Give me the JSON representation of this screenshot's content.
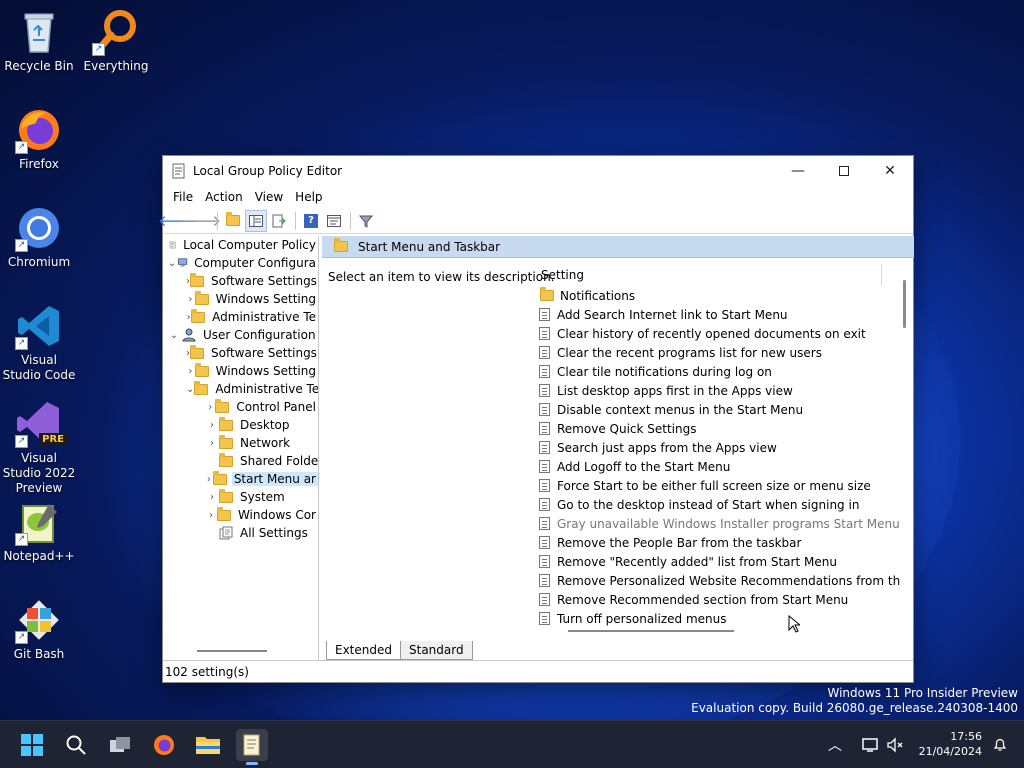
{
  "desktop": {
    "icons": [
      {
        "label": "Recycle Bin"
      },
      {
        "label": "Everything"
      },
      {
        "label": "Firefox"
      },
      {
        "label": "Chromium"
      },
      {
        "label": "Visual Studio Code"
      },
      {
        "label": "Visual Studio 2022 Preview",
        "badge": "PRE"
      },
      {
        "label": "Notepad++"
      },
      {
        "label": "Git Bash"
      }
    ]
  },
  "window": {
    "title": "Local Group Policy Editor",
    "menu": [
      "File",
      "Action",
      "View",
      "Help"
    ],
    "tree": [
      {
        "label": "Local Computer Policy"
      },
      {
        "label": "Computer Configura"
      },
      {
        "label": "Software Settings"
      },
      {
        "label": "Windows Setting"
      },
      {
        "label": "Administrative Te"
      },
      {
        "label": "User Configuration"
      },
      {
        "label": "Software Settings"
      },
      {
        "label": "Windows Setting"
      },
      {
        "label": "Administrative Te"
      },
      {
        "label": "Control Panel"
      },
      {
        "label": "Desktop"
      },
      {
        "label": "Network"
      },
      {
        "label": "Shared Folder"
      },
      {
        "label": "Start Menu ar"
      },
      {
        "label": "System"
      },
      {
        "label": "Windows Cor"
      },
      {
        "label": "All Settings"
      }
    ],
    "header": "Start Menu and Taskbar",
    "description": "Select an item to view its description.",
    "list_header": "Setting",
    "settings": [
      "Notifications",
      "Add Search Internet link to Start Menu",
      "Clear history of recently opened documents on exit",
      "Clear the recent programs list for new users",
      "Clear tile notifications during log on",
      "List desktop apps first in the Apps view",
      "Disable context menus in the Start Menu",
      "Remove Quick Settings",
      "Search just apps from the Apps view",
      "Add Logoff to the Start Menu",
      "Force Start to be either full screen size or menu size",
      "Go to the desktop instead of Start when signing in",
      "Gray unavailable Windows Installer programs Start Menu shortcuts",
      "Remove the People Bar from the taskbar",
      "Remove \"Recently added\" list from Start Menu",
      "Remove Personalized Website Recommendations from the ...",
      "Remove Recommended section from Start Menu",
      "Turn off personalized menus"
    ],
    "tabs": [
      "Extended",
      "Standard"
    ],
    "status": "102 setting(s)"
  },
  "watermark": {
    "line1": "Windows 11 Pro Insider Preview",
    "line2": "Evaluation copy. Build 26080.ge_release.240308-1400"
  },
  "taskbar": {
    "time": "17:56",
    "date": "21/04/2024"
  },
  "colors": {
    "selection": "#cce8ff",
    "header_band": "#c8daf0",
    "taskbar": "#1e2433"
  }
}
